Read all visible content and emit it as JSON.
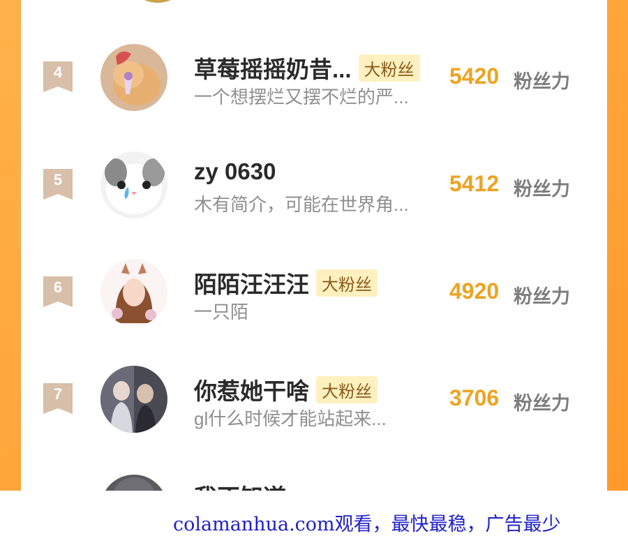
{
  "colors": {
    "accent_orange": "#eda321",
    "side_orange": "#ffa53a",
    "rank_badge": "#d7bfa9",
    "badge_bg": "#fff0bf",
    "footer_link": "#2020c8"
  },
  "score_label": "粉丝力",
  "rows": [
    {
      "rank": "4",
      "name": "草莓摇摇奶昔...",
      "badge": "大粉丝",
      "bio": "一个想摆烂又摆不烂的严...",
      "score": "5420"
    },
    {
      "rank": "5",
      "name": "zy 0630",
      "badge": "",
      "bio": "木有简介，可能在世界角...",
      "score": "5412"
    },
    {
      "rank": "6",
      "name": "陌陌汪汪汪",
      "badge": "大粉丝",
      "bio": "一只陌",
      "score": "4920"
    },
    {
      "rank": "7",
      "name": "你惹她干啥",
      "badge": "大粉丝",
      "bio": "gl什么时候才能站起来...",
      "score": "3706"
    }
  ],
  "partial_row": {
    "name": "我不知道ever"
  },
  "footer": {
    "text": "colamanhua.com观看，最快最稳，广告最少"
  }
}
